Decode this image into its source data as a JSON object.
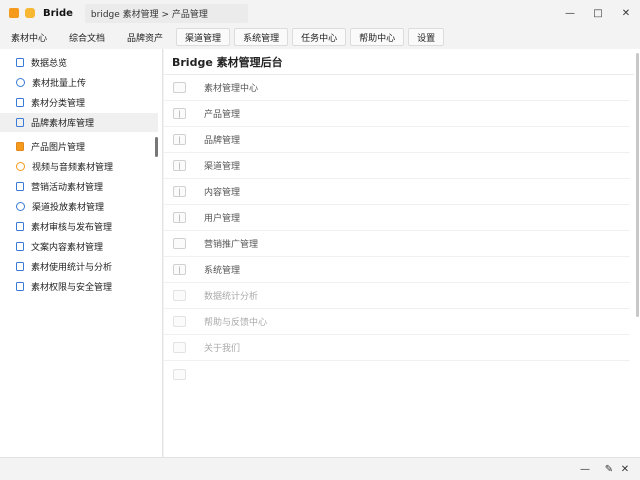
{
  "titlebar": {
    "app_name": "Bride",
    "path": "bridge 素材管理 > 产品管理",
    "minimize": "—",
    "maximize": "□",
    "close": "✕"
  },
  "tabs": [
    {
      "label": "素材中心"
    },
    {
      "label": "综合文档"
    },
    {
      "label": "品牌资产"
    },
    {
      "label": "渠道管理"
    },
    {
      "label": "系统管理"
    },
    {
      "label": "任务中心"
    },
    {
      "label": "帮助中心"
    },
    {
      "label": "设置"
    }
  ],
  "sidebar": {
    "items": [
      {
        "label": "数据总览",
        "icon": "doc-icon"
      },
      {
        "label": "素材批量上传",
        "icon": "clock-icon"
      },
      {
        "label": "素材分类管理",
        "icon": "tag-icon"
      },
      {
        "label": "品牌素材库管理",
        "icon": "folder-icon"
      },
      {
        "label": "产品图片管理",
        "icon": "image-icon"
      },
      {
        "label": "视频与音频素材管理",
        "icon": "media-icon"
      },
      {
        "label": "营销活动素材管理",
        "icon": "campaign-icon"
      },
      {
        "label": "渠道投放素材管理",
        "icon": "channel-icon"
      },
      {
        "label": "素材审核与发布管理",
        "icon": "review-icon"
      },
      {
        "label": "文案内容素材管理",
        "icon": "text-icon"
      },
      {
        "label": "素材使用统计与分析",
        "icon": "stats-icon"
      },
      {
        "label": "素材权限与安全管理",
        "icon": "lock-icon"
      }
    ]
  },
  "main": {
    "title": "Bridge 素材管理后台",
    "rows": [
      {
        "label": "素材管理中心"
      },
      {
        "label": "产品管理"
      },
      {
        "label": "品牌管理"
      },
      {
        "label": "渠道管理"
      },
      {
        "label": "内容管理"
      },
      {
        "label": "用户管理"
      },
      {
        "label": "营销推广管理"
      },
      {
        "label": "系统管理"
      },
      {
        "label": "数据统计分析"
      },
      {
        "label": "帮助与反馈中心"
      },
      {
        "label": "关于我们"
      },
      {
        "label": ""
      }
    ]
  },
  "statusbar": {
    "minus": "—",
    "edit": "✎",
    "close": "✕"
  }
}
